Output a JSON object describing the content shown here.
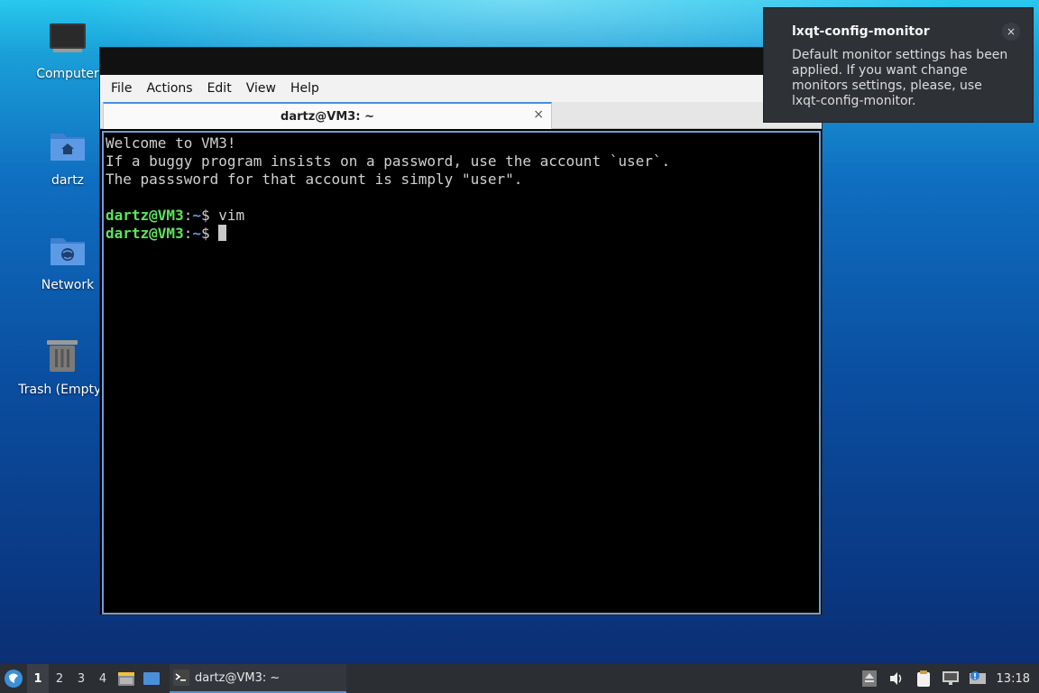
{
  "desktop": {
    "icons": [
      {
        "label": "Computer"
      },
      {
        "label": "dartz"
      },
      {
        "label": "Network"
      },
      {
        "label": "Trash (Empty)"
      }
    ]
  },
  "terminal": {
    "menu": [
      "File",
      "Actions",
      "Edit",
      "View",
      "Help"
    ],
    "tab_title": "dartz@VM3: ~",
    "tab_close": "×",
    "lines": [
      "Welcome to VM3!",
      "If a buggy program insists on a password, use the account `user`.",
      "The passsword for that account is simply \"user\"."
    ],
    "prompt_user": "dartz@VM3",
    "prompt_sep": ":",
    "prompt_path": "~",
    "prompt_sign": "$ ",
    "cmd1": "vim",
    "cmd2": ""
  },
  "notification": {
    "title": "lxqt-config-monitor",
    "body": "Default monitor settings has been applied. If you want change monitors settings, please, use lxqt-config-monitor.",
    "close": "×"
  },
  "taskbar": {
    "workspaces": [
      "1",
      "2",
      "3",
      "4"
    ],
    "active_workspace": "1",
    "task_label": "dartz@VM3: ~",
    "clock": "13:18"
  },
  "colors": {
    "accent": "#4a90d9",
    "prompt_user": "#5ee35e",
    "prompt_path": "#6a8ee8"
  }
}
